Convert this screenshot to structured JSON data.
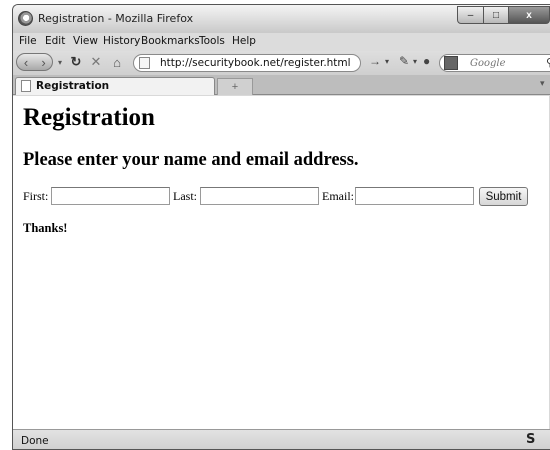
{
  "window": {
    "title": "Registration - Mozilla Firefox",
    "controls": {
      "minimize": "–",
      "maximize": "□",
      "close": "x"
    }
  },
  "menu": [
    "File",
    "Edit",
    "View",
    "History",
    "Bookmarks",
    "Tools",
    "Help"
  ],
  "navbar": {
    "url": "http://securitybook.net/register.html",
    "search_placeholder": "Google"
  },
  "tabs": {
    "active_label": "Registration",
    "new_tab": "+"
  },
  "page": {
    "heading": "Registration",
    "subheading": "Please enter your name and email address.",
    "form": {
      "first_label": "First:",
      "last_label": "Last:",
      "email_label": "Email:",
      "first_value": "",
      "last_value": "",
      "email_value": "",
      "submit_label": "Submit"
    },
    "message": "Thanks!"
  },
  "status": {
    "text": "Done",
    "icon": "S"
  }
}
